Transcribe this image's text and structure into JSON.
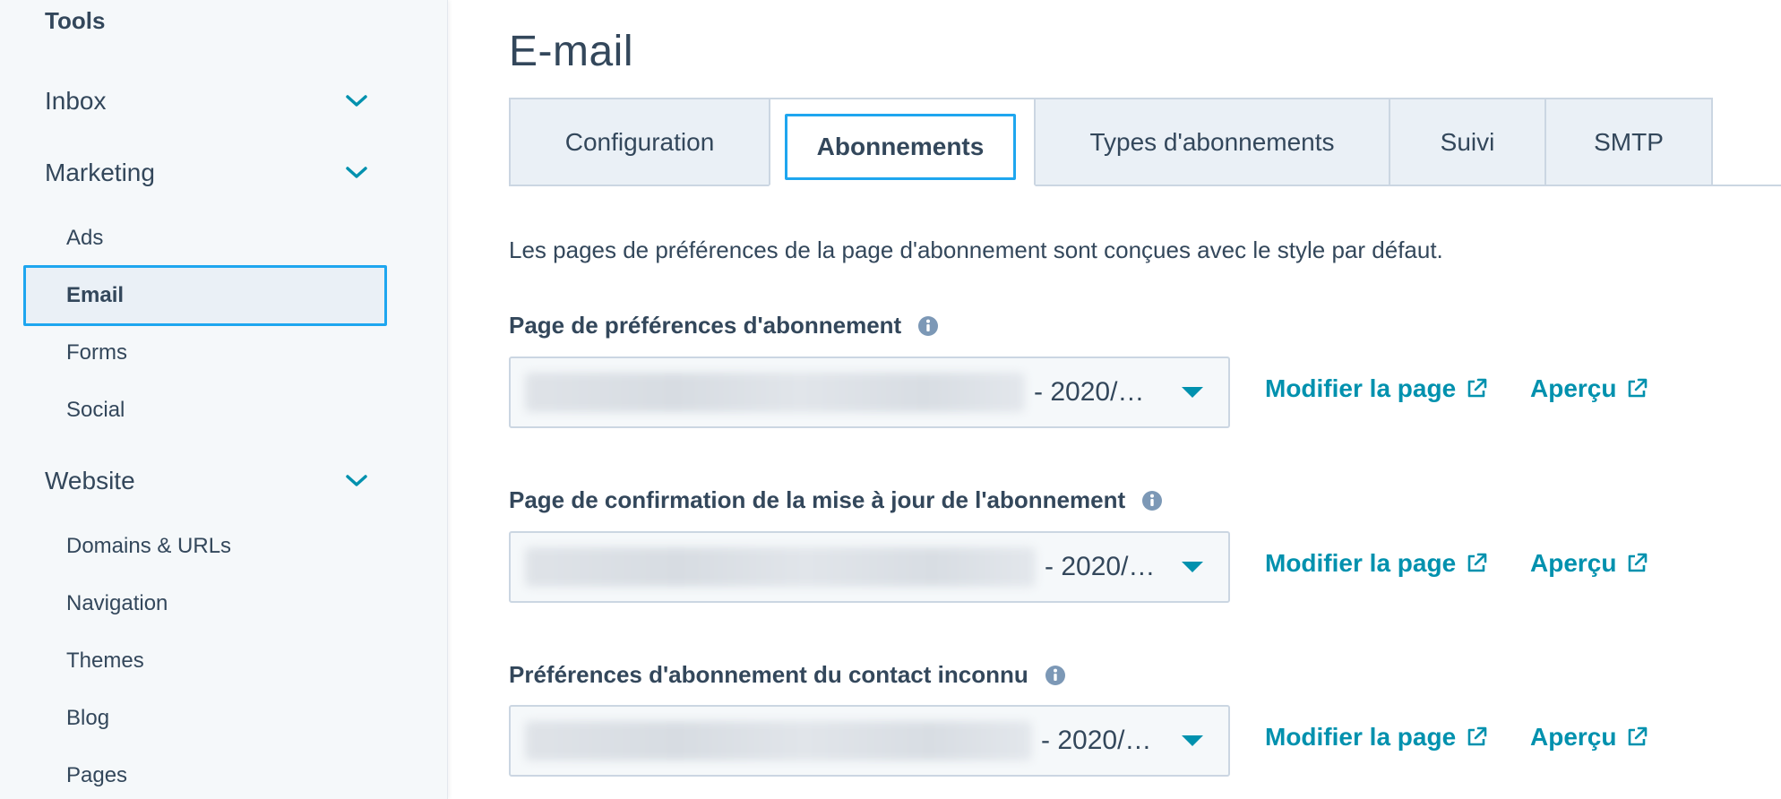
{
  "sidebar": {
    "title": "Tools",
    "groups": [
      {
        "label": "Inbox"
      },
      {
        "label": "Marketing"
      },
      {
        "label": "Website"
      }
    ],
    "marketing_items": [
      {
        "label": "Ads"
      },
      {
        "label": "Email"
      },
      {
        "label": "Forms"
      },
      {
        "label": "Social"
      }
    ],
    "website_items": [
      {
        "label": "Domains & URLs"
      },
      {
        "label": "Navigation"
      },
      {
        "label": "Themes"
      },
      {
        "label": "Blog"
      },
      {
        "label": "Pages"
      }
    ]
  },
  "main": {
    "title": "E-mail",
    "tabs": [
      {
        "label": "Configuration"
      },
      {
        "label": "Abonnements"
      },
      {
        "label": "Types d'abonnements"
      },
      {
        "label": "Suivi"
      },
      {
        "label": "SMTP"
      }
    ],
    "active_tab": "Abonnements",
    "description": "Les pages de préférences de la page d'abonnement sont conçues avec le style par défaut.",
    "fields": [
      {
        "label": "Page de préférences d'abonnement",
        "value_suffix": "- 2020/…",
        "edit_link": "Modifier la page",
        "preview_link": "Aperçu"
      },
      {
        "label": "Page de confirmation de la mise à jour de l'abonnement",
        "value_suffix": "- 2020/…",
        "edit_link": "Modifier la page",
        "preview_link": "Aperçu"
      },
      {
        "label": "Préférences d'abonnement du contact inconnu",
        "value_suffix": "- 2020/…",
        "edit_link": "Modifier la page",
        "preview_link": "Aperçu"
      }
    ]
  },
  "colors": {
    "accent": "#0091ae",
    "focus_ring": "#1ea6ef",
    "text": "#33475b",
    "tab_bg": "#eaf0f6",
    "border": "#cbd6e2",
    "sidebar_bg": "#f5f8fa"
  },
  "icons": {
    "chevron": "chevron-down-icon",
    "info": "info-icon",
    "external": "external-link-icon"
  }
}
